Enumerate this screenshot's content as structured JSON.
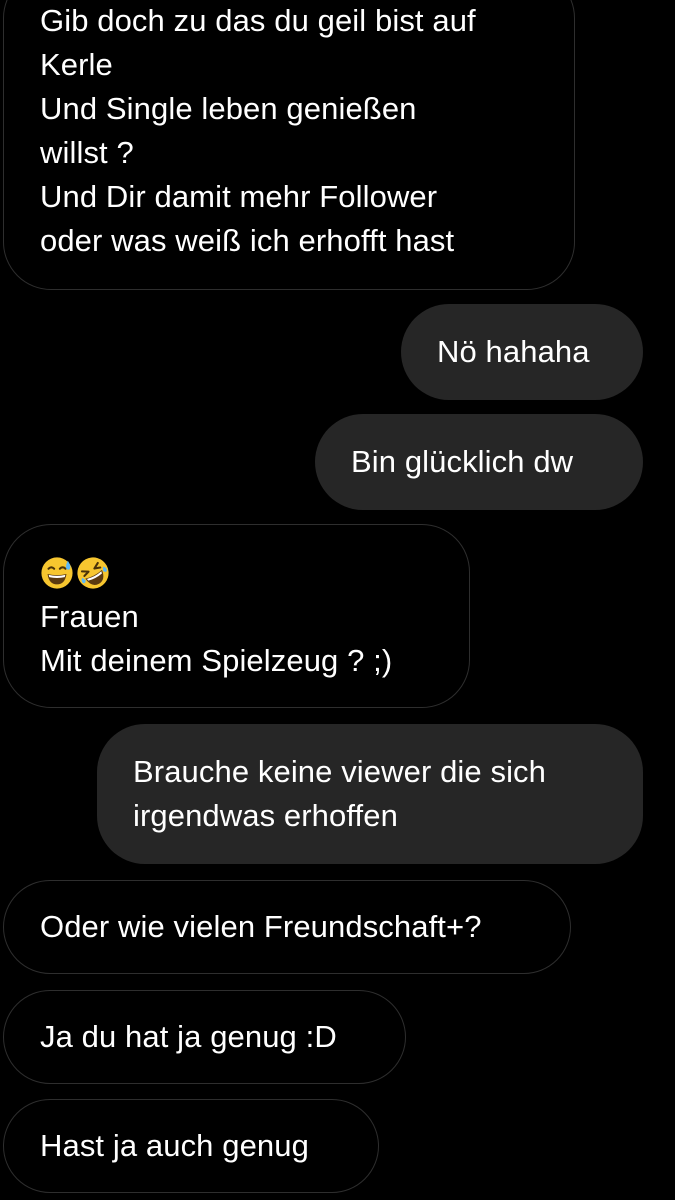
{
  "messages": [
    {
      "direction": "incoming",
      "lines": [
        "Gib doch zu das du geil bist auf",
        "Kerle",
        "Und Single leben genießen",
        "willst ?",
        "Und Dir damit mehr Follower",
        "oder was weiß ich erhofft hast"
      ]
    },
    {
      "direction": "outgoing",
      "lines": [
        "Nö hahaha"
      ]
    },
    {
      "direction": "outgoing",
      "lines": [
        "Bin glücklich dw"
      ]
    },
    {
      "direction": "incoming",
      "emojis": [
        "grinning-face-with-sweat",
        "rolling-on-the-floor-laughing"
      ],
      "lines": [
        "Frauen",
        "Mit deinem Spielzeug ? ;)"
      ]
    },
    {
      "direction": "outgoing",
      "lines": [
        "Brauche keine viewer die sich",
        "irgendwas erhoffen"
      ]
    },
    {
      "direction": "incoming",
      "lines": [
        "Oder wie vielen Freundschaft+?"
      ]
    },
    {
      "direction": "incoming",
      "lines": [
        "Ja du hat ja genug :D"
      ]
    },
    {
      "direction": "incoming",
      "lines": [
        "Hast ja auch genug"
      ]
    }
  ],
  "colors": {
    "background": "#000000",
    "outgoing_bubble": "#262626",
    "incoming_border": "#2e2e2e",
    "text": "#ffffff",
    "emoji_yellow": "#f7c62f"
  }
}
